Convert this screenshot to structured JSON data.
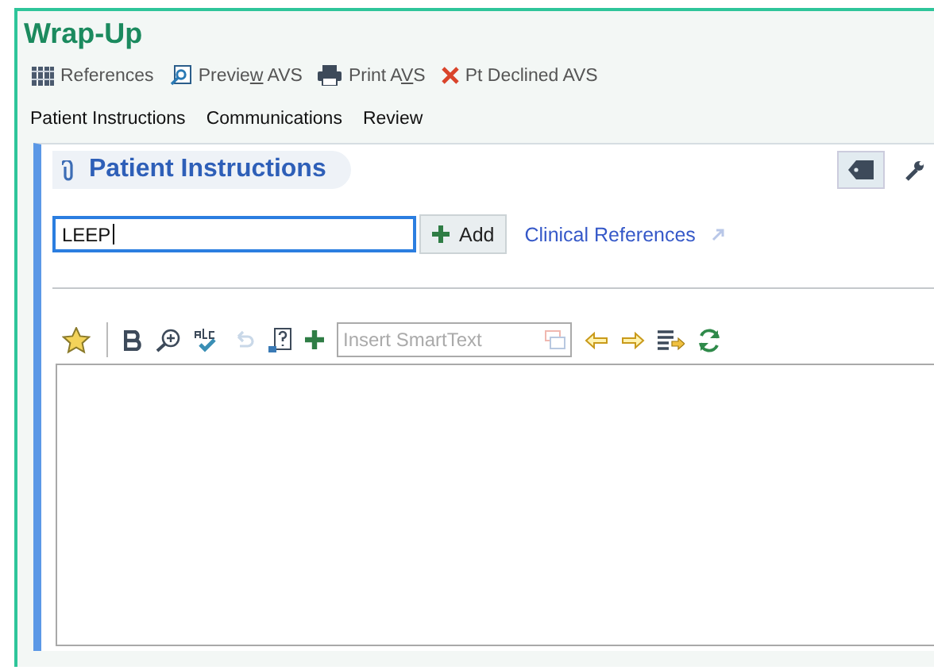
{
  "title": "Wrap-Up",
  "actions": [
    {
      "kind": "references",
      "label": "References"
    },
    {
      "kind": "preview",
      "before": "Previe",
      "accesskey": "w",
      "after": " AVS"
    },
    {
      "kind": "print",
      "before": "Print A",
      "accesskey": "V",
      "after": "S"
    },
    {
      "kind": "declined",
      "label": "Pt Declined AVS"
    }
  ],
  "sections": [
    "Patient Instructions",
    "Communications",
    "Review"
  ],
  "panel": {
    "title": "Patient Instructions",
    "search": {
      "value": "LEEP"
    },
    "add_button": "Add",
    "link": "Clinical References",
    "editor": {
      "smarttext": {
        "placeholder": "Insert SmartText"
      }
    }
  }
}
